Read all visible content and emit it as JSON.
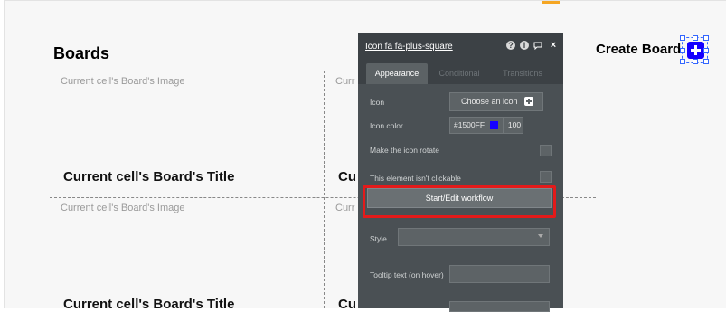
{
  "page": {
    "heading": "Boards",
    "image_placeholder": "Current cell's Board's Image",
    "title_placeholder": "Current cell's Board's Title",
    "title_placeholder_clipped": "Cu",
    "image_placeholder_clipped": "Curr",
    "create_board_label": "Create Board"
  },
  "panel": {
    "title": "Icon fa fa-plus-square",
    "header_icons": [
      "help-icon",
      "info-icon",
      "comment-icon",
      "close-icon"
    ],
    "tabs": [
      "Appearance",
      "Conditional",
      "Transitions"
    ],
    "active_tab": "Appearance",
    "icon_label": "Icon",
    "choose_icon_label": "Choose an icon",
    "icon_color_label": "Icon color",
    "icon_color_value": "#1500FF",
    "icon_opacity": "100",
    "rotate_label": "Make the icon rotate",
    "not_clickable_label": "This element isn't clickable",
    "workflow_button": "Start/Edit workflow",
    "style_label": "Style",
    "tooltip_label": "Tooltip text (on hover)"
  },
  "colors": {
    "icon_color": "#1500FF",
    "highlight": "#e41a1a",
    "panel_bg": "#4a5054"
  }
}
